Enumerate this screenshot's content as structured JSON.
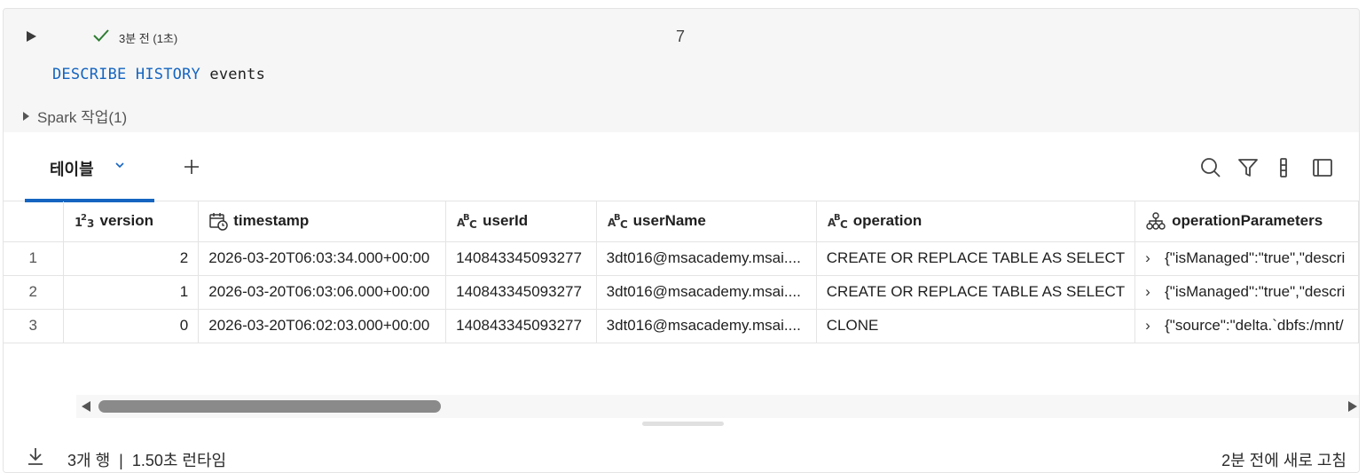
{
  "cell": {
    "status_text": "3분 전 (1초)",
    "cell_number": "7",
    "code": {
      "keyword1": "DESCRIBE",
      "keyword2": "HISTORY",
      "table": "events"
    },
    "spark_jobs_label": "Spark 작업(1)"
  },
  "result": {
    "tab_label": "테이블",
    "toolbar": [
      "search-icon",
      "filter-icon",
      "column-settings-icon",
      "sidebar-panel-icon"
    ],
    "columns": [
      {
        "label": "",
        "type": "rownum"
      },
      {
        "label": "version",
        "type": "int"
      },
      {
        "label": "timestamp",
        "type": "timestamp"
      },
      {
        "label": "userId",
        "type": "string"
      },
      {
        "label": "userName",
        "type": "string"
      },
      {
        "label": "operation",
        "type": "string"
      },
      {
        "label": "operationParameters",
        "type": "map"
      }
    ],
    "rows": [
      {
        "n": "1",
        "version": "2",
        "timestamp": "2026-03-20T06:03:34.000+00:00",
        "userId": "140843345093277",
        "userName": "3dt016@msacademy.msai....",
        "operation": "CREATE OR REPLACE TABLE AS SELECT",
        "params": "{\"isManaged\":\"true\",\"descri"
      },
      {
        "n": "2",
        "version": "1",
        "timestamp": "2026-03-20T06:03:06.000+00:00",
        "userId": "140843345093277",
        "userName": "3dt016@msacademy.msai....",
        "operation": "CREATE OR REPLACE TABLE AS SELECT",
        "params": "{\"isManaged\":\"true\",\"descri"
      },
      {
        "n": "3",
        "version": "0",
        "timestamp": "2026-03-20T06:02:03.000+00:00",
        "userId": "140843345093277",
        "userName": "3dt016@msacademy.msai....",
        "operation": "CLONE",
        "params": "{\"source\":\"delta.`dbfs:/mnt/"
      }
    ],
    "footer": {
      "row_count": "3개 행",
      "separator": "|",
      "runtime": "1.50초 런타임",
      "refresh": "2분 전에 새로 고침"
    }
  },
  "colors": {
    "accent": "#1565c0",
    "success": "#2e7d32",
    "cell_bg": "#f6f6f6"
  }
}
